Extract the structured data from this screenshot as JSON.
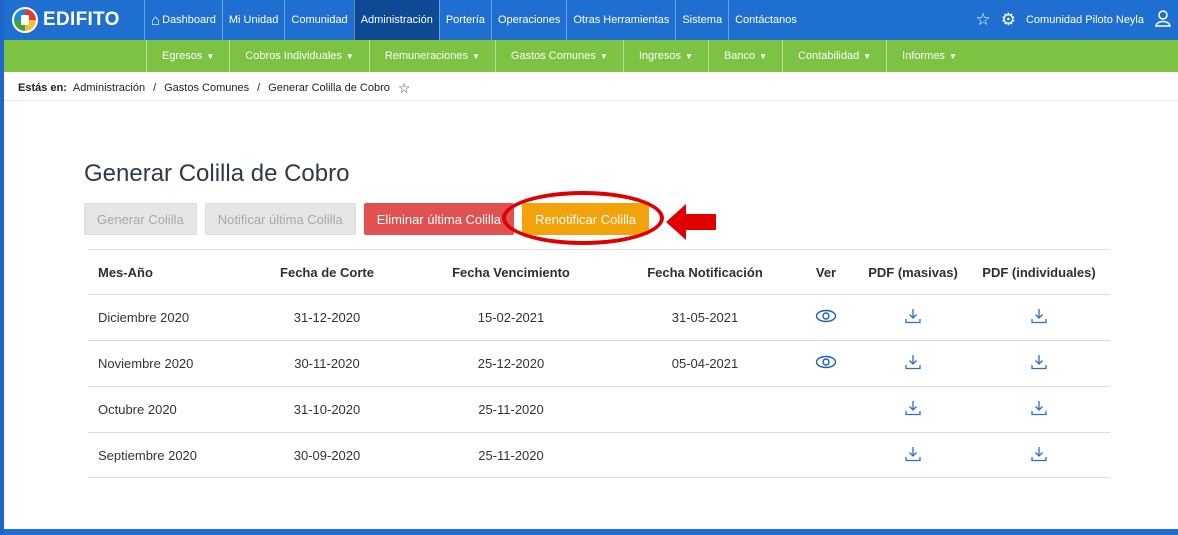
{
  "brand": {
    "name": "EDIFITO"
  },
  "top_nav": {
    "items": [
      {
        "label": "Dashboard",
        "active": false
      },
      {
        "label": "Mi Unidad",
        "active": false
      },
      {
        "label": "Comunidad",
        "active": false
      },
      {
        "label": "Administración",
        "active": true
      },
      {
        "label": "Portería",
        "active": false
      },
      {
        "label": "Operaciones",
        "active": false
      },
      {
        "label": "Otras Herramientas",
        "active": false
      },
      {
        "label": "Sistema",
        "active": false
      },
      {
        "label": "Contáctanos",
        "active": false
      }
    ],
    "user": "Comunidad Piloto Neyla"
  },
  "sub_nav": {
    "items": [
      {
        "label": "Egresos"
      },
      {
        "label": "Cobros Individuales"
      },
      {
        "label": "Remuneraciones"
      },
      {
        "label": "Gastos Comunes"
      },
      {
        "label": "Ingresos"
      },
      {
        "label": "Banco"
      },
      {
        "label": "Contabilidad"
      },
      {
        "label": "Informes"
      }
    ]
  },
  "breadcrumb": {
    "prefix": "Estás en:",
    "items": [
      "Administración",
      "Gastos Comunes",
      "Generar Colilla de Cobro"
    ]
  },
  "page": {
    "title": "Generar Colilla de Cobro",
    "buttons": {
      "generar": "Generar Colilla",
      "notificar": "Notificar última Colilla",
      "eliminar": "Eliminar última Colilla",
      "renotificar": "Renotificar Colilla"
    }
  },
  "table": {
    "headers": [
      "Mes-Año",
      "Fecha de Corte",
      "Fecha Vencimiento",
      "Fecha Notificación",
      "Ver",
      "PDF (masivas)",
      "PDF (individuales)"
    ],
    "rows": [
      {
        "mes": "Diciembre 2020",
        "corte": "31-12-2020",
        "vencimiento": "15-02-2021",
        "notificacion": "31-05-2021",
        "ver": true
      },
      {
        "mes": "Noviembre 2020",
        "corte": "30-11-2020",
        "vencimiento": "25-12-2020",
        "notificacion": "05-04-2021",
        "ver": true
      },
      {
        "mes": "Octubre 2020",
        "corte": "31-10-2020",
        "vencimiento": "25-11-2020",
        "notificacion": "",
        "ver": false
      },
      {
        "mes": "Septiembre 2020",
        "corte": "30-09-2020",
        "vencimiento": "25-11-2020",
        "notificacion": "",
        "ver": false
      }
    ]
  },
  "colors": {
    "top_nav": "#1e6fd0",
    "sub_nav": "#7cc243",
    "danger": "#e05252",
    "warning": "#f2a20a",
    "highlight": "#e00000"
  },
  "icons": {
    "home": "home-icon",
    "star": "star-icon",
    "gear": "gear-icon",
    "user": "user-icon",
    "eye": "eye-icon",
    "download": "download-icon"
  }
}
